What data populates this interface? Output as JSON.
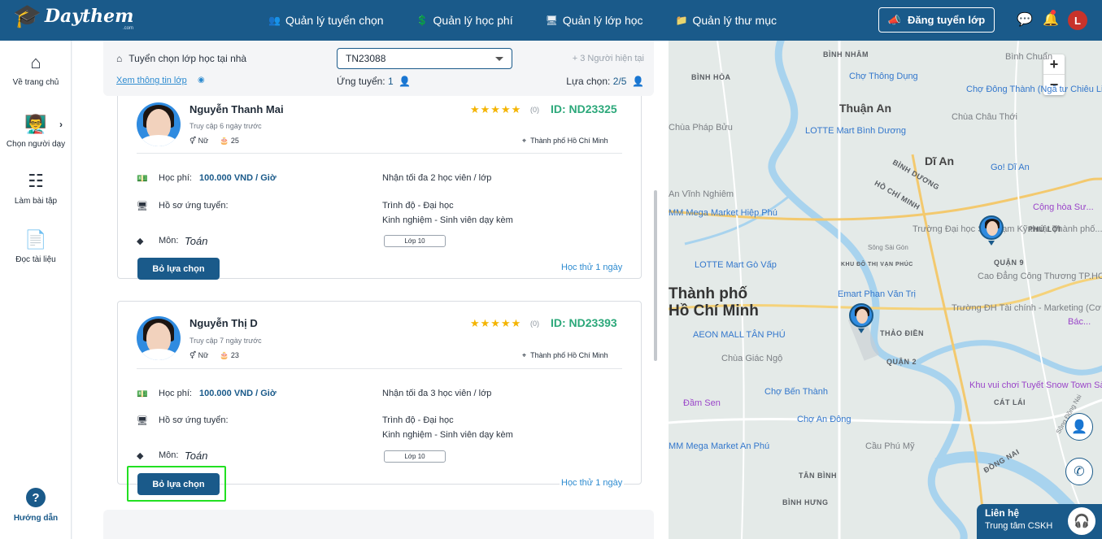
{
  "header": {
    "logo_text": "Daythem",
    "logo_sub": ".com",
    "nav": [
      {
        "label": "Quản lý tuyển chọn",
        "icon": "people-icon"
      },
      {
        "label": "Quản lý học phí",
        "icon": "money-icon"
      },
      {
        "label": "Quản lý lớp học",
        "icon": "monitor-icon"
      },
      {
        "label": "Quản lý thư mục",
        "icon": "folder-icon"
      }
    ],
    "post_button": "Đăng tuyển lớp",
    "avatar_initial": "L"
  },
  "sidebar": {
    "items": [
      {
        "label": "Về trang chủ",
        "icon": "home-icon"
      },
      {
        "label": "Chọn người dạy",
        "icon": "teacher-icon"
      },
      {
        "label": "Làm bài tập",
        "icon": "assignment-icon"
      },
      {
        "label": "Đọc tài liệu",
        "icon": "pdf-icon"
      }
    ],
    "help_label": "Hướng dẫn"
  },
  "filter": {
    "title": "Tuyển chọn lớp học tại nhà",
    "class_code": "TN23088",
    "watching": "+ 3 Người hiện tại",
    "view_info": "Xem thông tin lớp",
    "applied_label": "Ứng tuyển:",
    "applied_count": "1",
    "selected_label": "Lựa chọn:",
    "selected_count": "2/5"
  },
  "tutors": [
    {
      "name": "Nguyễn Thanh Mai",
      "access": "Truy cập 6 ngày trước",
      "gender": "Nữ",
      "age": "25",
      "stars": "★★★★★",
      "rating_count": "(0)",
      "id": "ID: ND23325",
      "location": "Thành phố Hồ Chí Minh",
      "fee_label": "Học phí:",
      "fee": "100.000 VND / Giờ",
      "max_students": "Nhận tối đa 2 học viên / lớp",
      "profile_label": "Hồ sơ ứng tuyển:",
      "level": "Trình độ - Đại học",
      "experience": "Kinh nghiệm - Sinh viên dạy kèm",
      "subject_label": "Môn:",
      "subject": "Toán",
      "grade": "Lớp 10",
      "button": "Bỏ lựa chọn",
      "trial": "Học thử 1 ngày"
    },
    {
      "name": "Nguyễn Thị D",
      "access": "Truy cập 7 ngày trước",
      "gender": "Nữ",
      "age": "23",
      "stars": "★★★★★",
      "rating_count": "(0)",
      "id": "ID: ND23393",
      "location": "Thành phố Hồ Chí Minh",
      "fee_label": "Học phí:",
      "fee": "100.000 VND / Giờ",
      "max_students": "Nhận tối đa 3 học viên / lớp",
      "profile_label": "Hồ sơ ứng tuyển:",
      "level": "Trình độ - Đại học",
      "experience": "Kinh nghiệm - Sinh viên dạy kèm",
      "subject_label": "Môn:",
      "subject": "Toán",
      "grade": "Lớp 10",
      "button": "Bỏ lựa chọn",
      "trial": "Học thử 1 ngày"
    }
  ],
  "map": {
    "labels": [
      "Thuận An",
      "Dĩ An",
      "BÌNH DƯƠNG",
      "HỒ CHÍ MINH",
      "Thành phố",
      "Hồ Chí Minh",
      "Chợ Thông Dụng",
      "Chợ Đông Thành (Ngã tư Chiêu Liêu)",
      "Chùa Châu Thới",
      "Chùa Pháp Bửu",
      "LOTTE Mart Bình Dương",
      "Go! Dĩ An",
      "Bình Chuẩn",
      "BÌNH HÒA",
      "An Vĩnh Nghiêm",
      "MM Mega Market Hiệp Phú",
      "LOTTE Mart Gò Vấp",
      "Emart Phan Văn Trị",
      "Trường Đại học Sư phạm Kỹ thuật Thành phố...",
      "Cao Đẳng Công Thương TP.HCM",
      "Trường ĐH Tài chính - Marketing (Cơ sở...",
      "AEON MALL TÂN PHÚ",
      "Chùa Giác Ngộ",
      "Chợ Bến Thành",
      "Khu vui chơi Tuyết Snow Town Sài Gòn",
      "Đầm Sen",
      "Chợ An Đông",
      "MM Mega Market An Phú",
      "Cầu Phú Mỹ",
      "BÌNH HƯNG",
      "ĐỒNG NAI",
      "THẢO ĐIỀN",
      "QUẬN 2",
      "QUẬN 9",
      "CÁT LÁI",
      "KHU ĐÔ THỊ VẠN PHÚC",
      "PHÚ LỢI",
      "TÂN BÌNH",
      "BÌNH NHÂM",
      "Sông Sài Gòn",
      "Sông Đồng Nai",
      "Cộng hòa Sư...",
      "Bác..."
    ],
    "contact_title": "Liên hệ",
    "contact_sub": "Trung tâm CSKH"
  }
}
